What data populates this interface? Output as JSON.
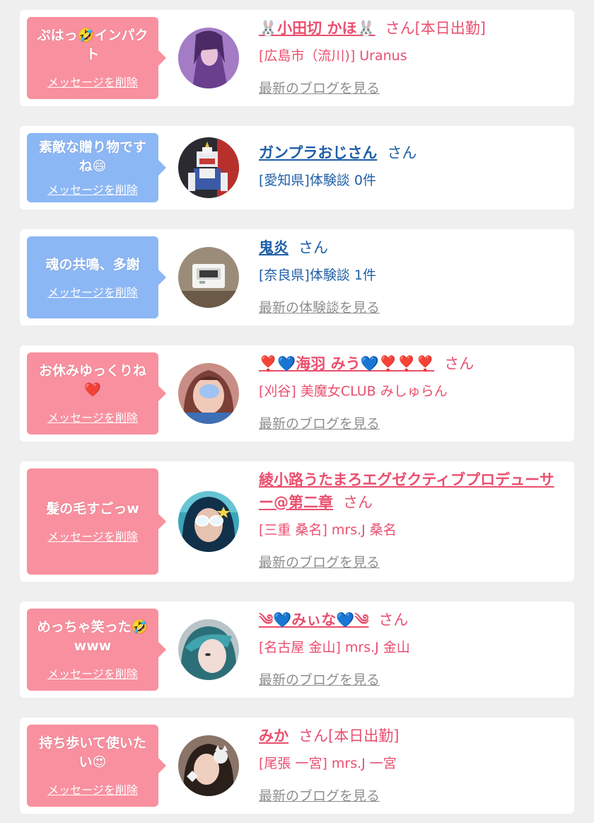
{
  "items": [
    {
      "message": "ぷはっ🤣インパクト",
      "delete_label": "メッセージを削除",
      "name": "🐰小田切 かほ🐰",
      "honorific": "さん[本日出勤]",
      "sub": "[広島市（流川)] Uranus",
      "link": "最新のブログを見る",
      "theme": "pink"
    },
    {
      "message": "素敵な贈り物ですね😄",
      "delete_label": "メッセージを削除",
      "name": "ガンプラおじさん",
      "honorific": "さん",
      "sub": "[愛知県]体験談 0件",
      "link": "",
      "theme": "blue"
    },
    {
      "message": "魂の共鳴、多謝",
      "delete_label": "メッセージを削除",
      "name": "鬼炎",
      "honorific": "さん",
      "sub": "[奈良県]体験談 1件",
      "link": "最新の体験談を見る",
      "theme": "blue"
    },
    {
      "message": "お休みゆっくりね❤️",
      "delete_label": "メッセージを削除",
      "name": "❣️💙海羽 みう💙❣️❣️❣️",
      "honorific": "さん",
      "sub": "[刈谷] 美魔女CLUB みしゅらん",
      "link": "最新のブログを見る",
      "theme": "pink"
    },
    {
      "message": "髪の毛すごっw",
      "delete_label": "メッセージを削除",
      "name": "綾小路うたまろエグゼクティブプロデューサー@第二章",
      "honorific": "さん",
      "sub": "[三重 桑名] mrs.J 桑名",
      "link": "最新のブログを見る",
      "theme": "pink"
    },
    {
      "message": "めっちゃ笑った🤣www",
      "delete_label": "メッセージを削除",
      "name": "༄💙みぃな💙༄",
      "honorific": "さん",
      "sub": "[名古屋 金山] mrs.J 金山",
      "link": "最新のブログを見る",
      "theme": "pink"
    },
    {
      "message": "持ち歩いて使いたい😍",
      "delete_label": "メッセージを削除",
      "name": "みか",
      "honorific": "さん[本日出勤]",
      "sub": "[尾張 一宮] mrs.J 一宮",
      "link": "最新のブログを見る",
      "theme": "pink"
    }
  ],
  "colors": {
    "pink_accent": "#ea4f6e",
    "blue_accent": "#1f5fa8",
    "pink_bubble": "#f9909f",
    "blue_bubble": "#8cb7f5",
    "link_gray": "#8e8e8e"
  }
}
